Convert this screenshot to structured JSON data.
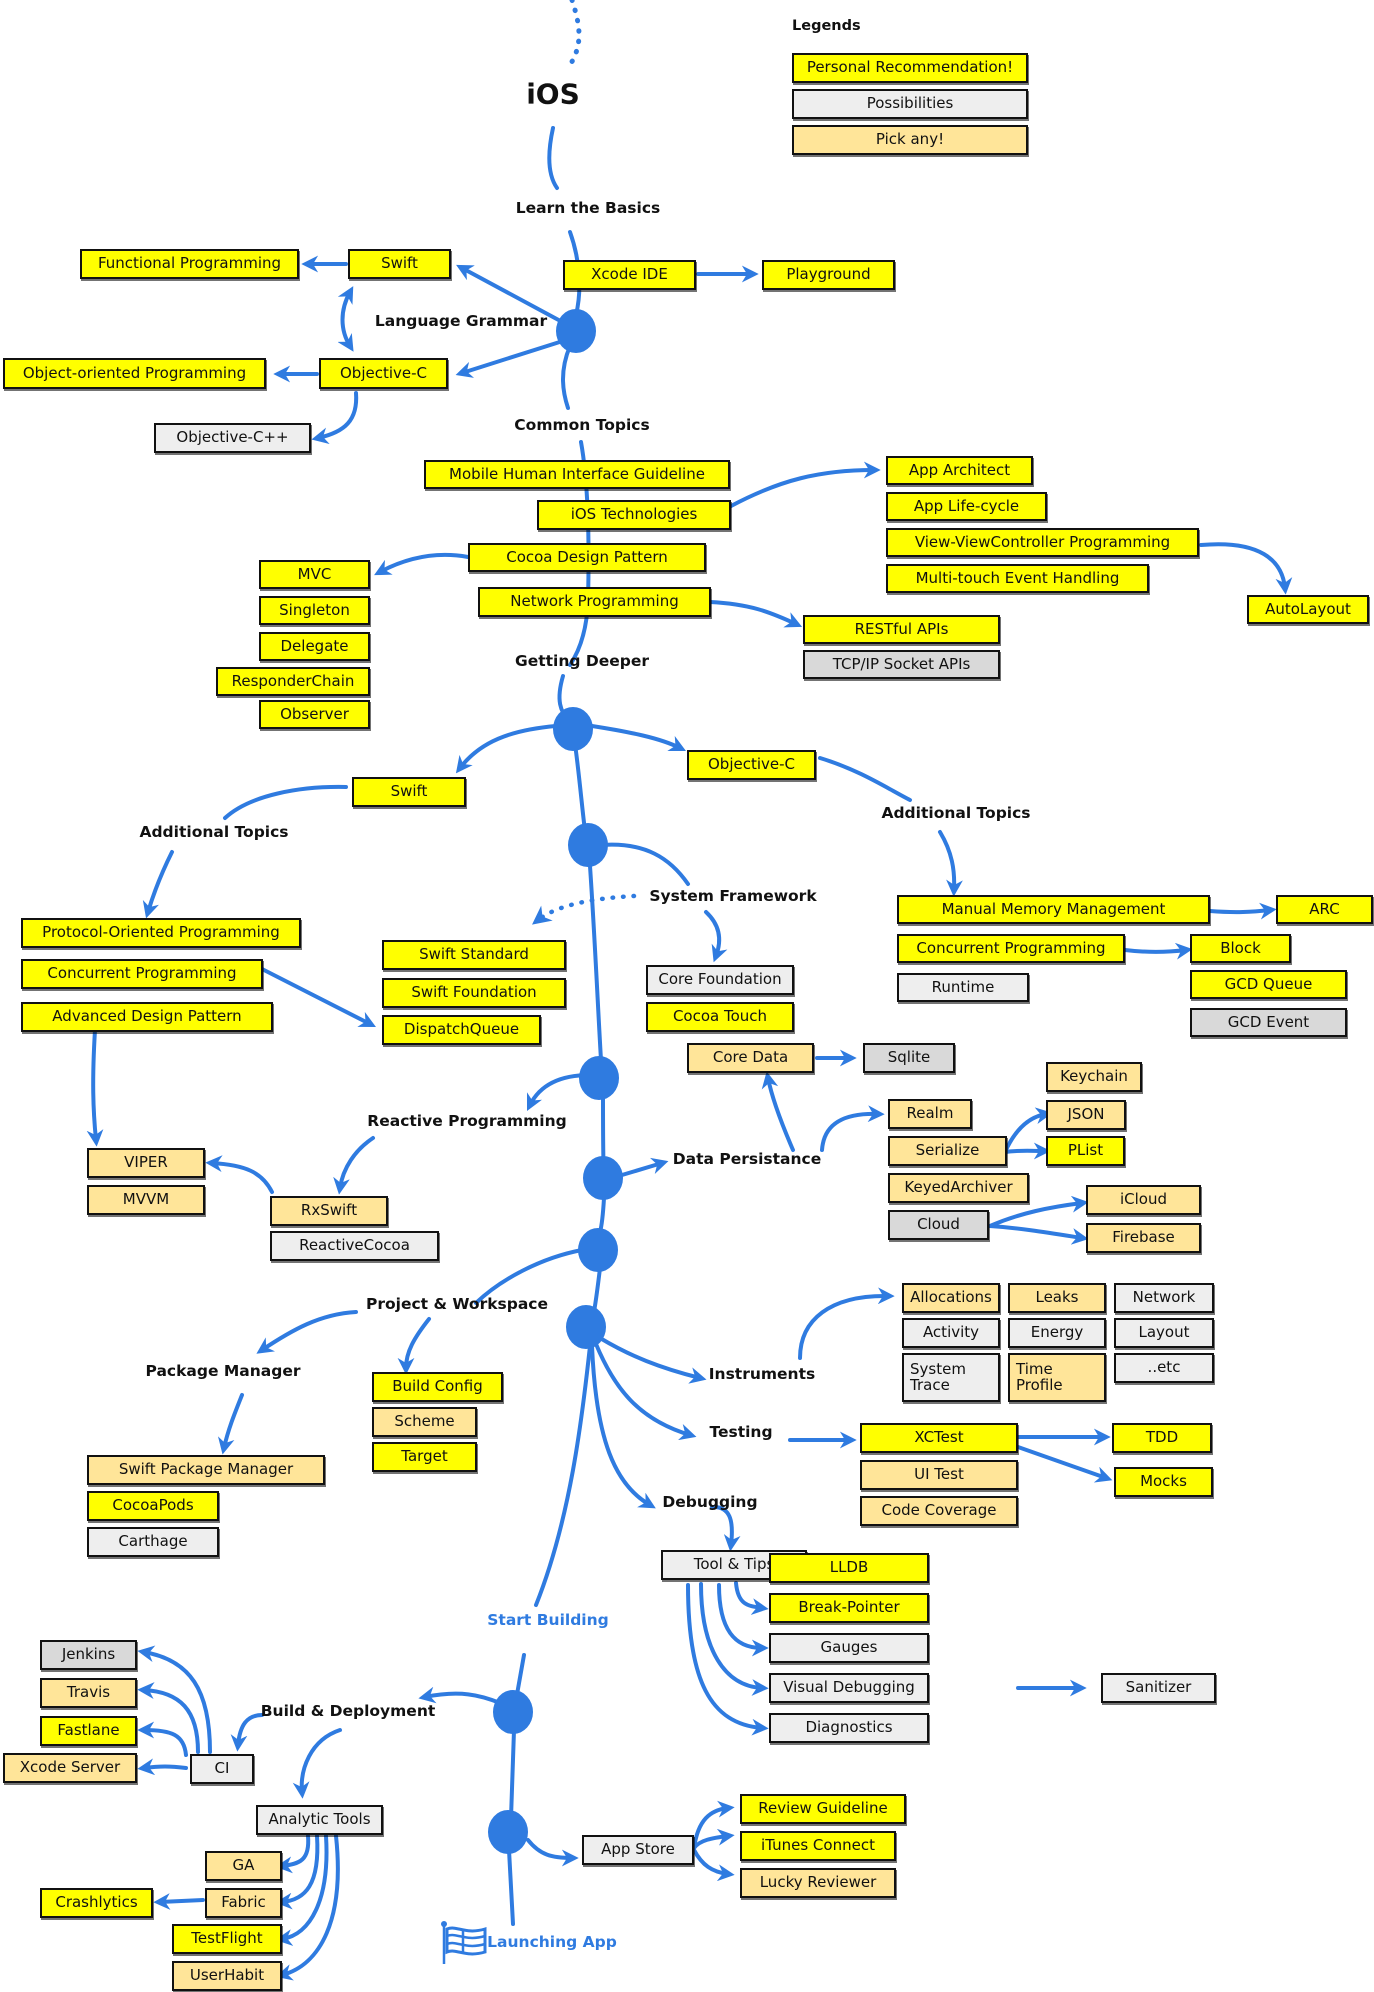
{
  "title": "iOS",
  "legend": {
    "title": "Legends",
    "items": [
      {
        "label": "Personal Recommendation!",
        "type": "rec"
      },
      {
        "label": "Possibilities",
        "type": "pos"
      },
      {
        "label": "Pick any!",
        "type": "pick"
      }
    ]
  },
  "colors": {
    "recommendation": "#FFFF00",
    "possibility": "#EEEEEE",
    "possibility_dark": "#D9D9D9",
    "pick_any": "#FFE599",
    "connector": "#2F7BE0"
  },
  "section_labels": {
    "learn_basics": "Learn the Basics",
    "language_grammar": "Language Grammar",
    "common_topics": "Common Topics",
    "getting_deeper": "Getting Deeper",
    "additional_topics_swift": "Additional Topics",
    "additional_topics_objc": "Additional Topics",
    "system_framework": "System Framework",
    "reactive_programming": "Reactive Programming",
    "data_persistance": "Data Persistance",
    "project_workspace": "Project & Workspace",
    "package_manager": "Package Manager",
    "instruments": "Instruments",
    "testing": "Testing",
    "debugging": "Debugging",
    "start_building": "Start Building",
    "build_deployment": "Build & Deployment",
    "launching_app": "Launching App"
  },
  "nodes": {
    "xcode_ide": {
      "label": "Xcode IDE",
      "type": "rec"
    },
    "playground": {
      "label": "Playground",
      "type": "rec"
    },
    "swift_basic": {
      "label": "Swift",
      "type": "rec"
    },
    "functional_programming": {
      "label": "Functional Programming",
      "type": "rec"
    },
    "objc_basic": {
      "label": "Objective-C",
      "type": "rec"
    },
    "oop": {
      "label": "Object-oriented Programming",
      "type": "rec"
    },
    "objcpp": {
      "label": "Objective-C++",
      "type": "pos"
    },
    "hig": {
      "label": "Mobile Human Interface Guideline",
      "type": "rec"
    },
    "ios_tech": {
      "label": "iOS Technologies",
      "type": "rec"
    },
    "cocoa_design": {
      "label": "Cocoa Design Pattern",
      "type": "rec"
    },
    "network_prog": {
      "label": "Network Programming",
      "type": "rec"
    },
    "mvc": {
      "label": "MVC",
      "type": "rec"
    },
    "singleton": {
      "label": "Singleton",
      "type": "rec"
    },
    "delegate": {
      "label": "Delegate",
      "type": "rec"
    },
    "responder_chain": {
      "label": "ResponderChain",
      "type": "rec"
    },
    "observer": {
      "label": "Observer",
      "type": "rec"
    },
    "app_architect": {
      "label": "App Architect",
      "type": "rec"
    },
    "app_lifecycle": {
      "label": "App Life-cycle",
      "type": "rec"
    },
    "view_vc": {
      "label": "View-ViewController Programming",
      "type": "rec"
    },
    "multitouch": {
      "label": "Multi-touch Event Handling",
      "type": "rec"
    },
    "autolayout": {
      "label": "AutoLayout",
      "type": "rec"
    },
    "restful": {
      "label": "RESTful APIs",
      "type": "rec"
    },
    "tcpip": {
      "label": "TCP/IP Socket APIs",
      "type": "pos2"
    },
    "swift_deep": {
      "label": "Swift",
      "type": "rec"
    },
    "objc_deep": {
      "label": "Objective-C",
      "type": "rec"
    },
    "pop": {
      "label": "Protocol-Oriented Programming",
      "type": "rec"
    },
    "concurrent_swift": {
      "label": "Concurrent Programming",
      "type": "rec"
    },
    "adv_design": {
      "label": "Advanced Design Pattern",
      "type": "rec"
    },
    "swift_standard": {
      "label": "Swift Standard",
      "type": "rec"
    },
    "swift_foundation": {
      "label": "Swift Foundation",
      "type": "rec"
    },
    "dispatch_queue": {
      "label": "DispatchQueue",
      "type": "rec"
    },
    "core_foundation": {
      "label": "Core Foundation",
      "type": "pos"
    },
    "cocoa_touch": {
      "label": "Cocoa Touch",
      "type": "rec"
    },
    "mmm": {
      "label": "Manual Memory Management",
      "type": "rec"
    },
    "arc": {
      "label": "ARC",
      "type": "rec"
    },
    "concurrent_objc": {
      "label": "Concurrent Programming",
      "type": "rec"
    },
    "block": {
      "label": "Block",
      "type": "rec"
    },
    "gcd_queue": {
      "label": "GCD Queue",
      "type": "rec"
    },
    "gcd_event": {
      "label": "GCD Event",
      "type": "pos2"
    },
    "runtime": {
      "label": "Runtime",
      "type": "pos"
    },
    "core_data": {
      "label": "Core Data",
      "type": "pick"
    },
    "sqlite": {
      "label": "Sqlite",
      "type": "pos2"
    },
    "keychain": {
      "label": "Keychain",
      "type": "pick"
    },
    "realm": {
      "label": "Realm",
      "type": "pick"
    },
    "json": {
      "label": "JSON",
      "type": "pick"
    },
    "serialize": {
      "label": "Serialize",
      "type": "pick"
    },
    "plist": {
      "label": "PList",
      "type": "rec"
    },
    "keyed_archiver": {
      "label": "KeyedArchiver",
      "type": "pick"
    },
    "icloud": {
      "label": "iCloud",
      "type": "pick"
    },
    "cloud": {
      "label": "Cloud",
      "type": "pos2"
    },
    "firebase": {
      "label": "Firebase",
      "type": "pick"
    },
    "viper": {
      "label": "VIPER",
      "type": "pick"
    },
    "mvvm": {
      "label": "MVVM",
      "type": "pick"
    },
    "rxswift": {
      "label": "RxSwift",
      "type": "pick"
    },
    "reactive_cocoa": {
      "label": "ReactiveCocoa",
      "type": "pos"
    },
    "build_config": {
      "label": "Build Config",
      "type": "rec"
    },
    "scheme": {
      "label": "Scheme",
      "type": "pick"
    },
    "target": {
      "label": "Target",
      "type": "rec"
    },
    "spm": {
      "label": "Swift Package Manager",
      "type": "pick"
    },
    "cocoapods": {
      "label": "CocoaPods",
      "type": "rec"
    },
    "carthage": {
      "label": "Carthage",
      "type": "pos"
    },
    "allocations": {
      "label": "Allocations",
      "type": "pick"
    },
    "leaks": {
      "label": "Leaks",
      "type": "pick"
    },
    "network": {
      "label": "Network",
      "type": "pos"
    },
    "activity": {
      "label": "Activity",
      "type": "pos"
    },
    "energy": {
      "label": "Energy",
      "type": "pos"
    },
    "layout": {
      "label": "Layout",
      "type": "pos"
    },
    "system_trace": {
      "label": "System Trace",
      "type": "pos"
    },
    "time_profile": {
      "label": "Time Profile",
      "type": "pick"
    },
    "etc": {
      "label": "..etc",
      "type": "pos"
    },
    "xctest": {
      "label": "XCTest",
      "type": "rec"
    },
    "tdd": {
      "label": "TDD",
      "type": "rec"
    },
    "ui_test": {
      "label": "UI Test",
      "type": "pick"
    },
    "mocks": {
      "label": "Mocks",
      "type": "rec"
    },
    "code_coverage": {
      "label": "Code Coverage",
      "type": "pick"
    },
    "tool_tips": {
      "label": "Tool & Tips",
      "type": "pos"
    },
    "lldb": {
      "label": "LLDB",
      "type": "rec"
    },
    "break_pointer": {
      "label": "Break-Pointer",
      "type": "rec"
    },
    "gauges": {
      "label": "Gauges",
      "type": "pos"
    },
    "visual_debugging": {
      "label": "Visual Debugging",
      "type": "pos"
    },
    "sanitizer": {
      "label": "Sanitizer",
      "type": "pos"
    },
    "diagnostics": {
      "label": "Diagnostics",
      "type": "pos"
    },
    "jenkins": {
      "label": "Jenkins",
      "type": "pos2"
    },
    "travis": {
      "label": "Travis",
      "type": "pick"
    },
    "fastlane": {
      "label": "Fastlane",
      "type": "rec"
    },
    "xcode_server": {
      "label": "Xcode Server",
      "type": "pick"
    },
    "ci": {
      "label": "CI",
      "type": "pos"
    },
    "analytic_tools": {
      "label": "Analytic Tools",
      "type": "pos"
    },
    "ga": {
      "label": "GA",
      "type": "pick"
    },
    "fabric": {
      "label": "Fabric",
      "type": "pick"
    },
    "crashlytics": {
      "label": "Crashlytics",
      "type": "rec"
    },
    "testflight": {
      "label": "TestFlight",
      "type": "rec"
    },
    "userhabit": {
      "label": "UserHabit",
      "type": "pick"
    },
    "app_store": {
      "label": "App Store",
      "type": "pos"
    },
    "review_guideline": {
      "label": "Review Guideline",
      "type": "rec"
    },
    "itunes_connect": {
      "label": "iTunes Connect",
      "type": "rec"
    },
    "lucky_reviewer": {
      "label": "Lucky Reviewer",
      "type": "pick"
    }
  }
}
